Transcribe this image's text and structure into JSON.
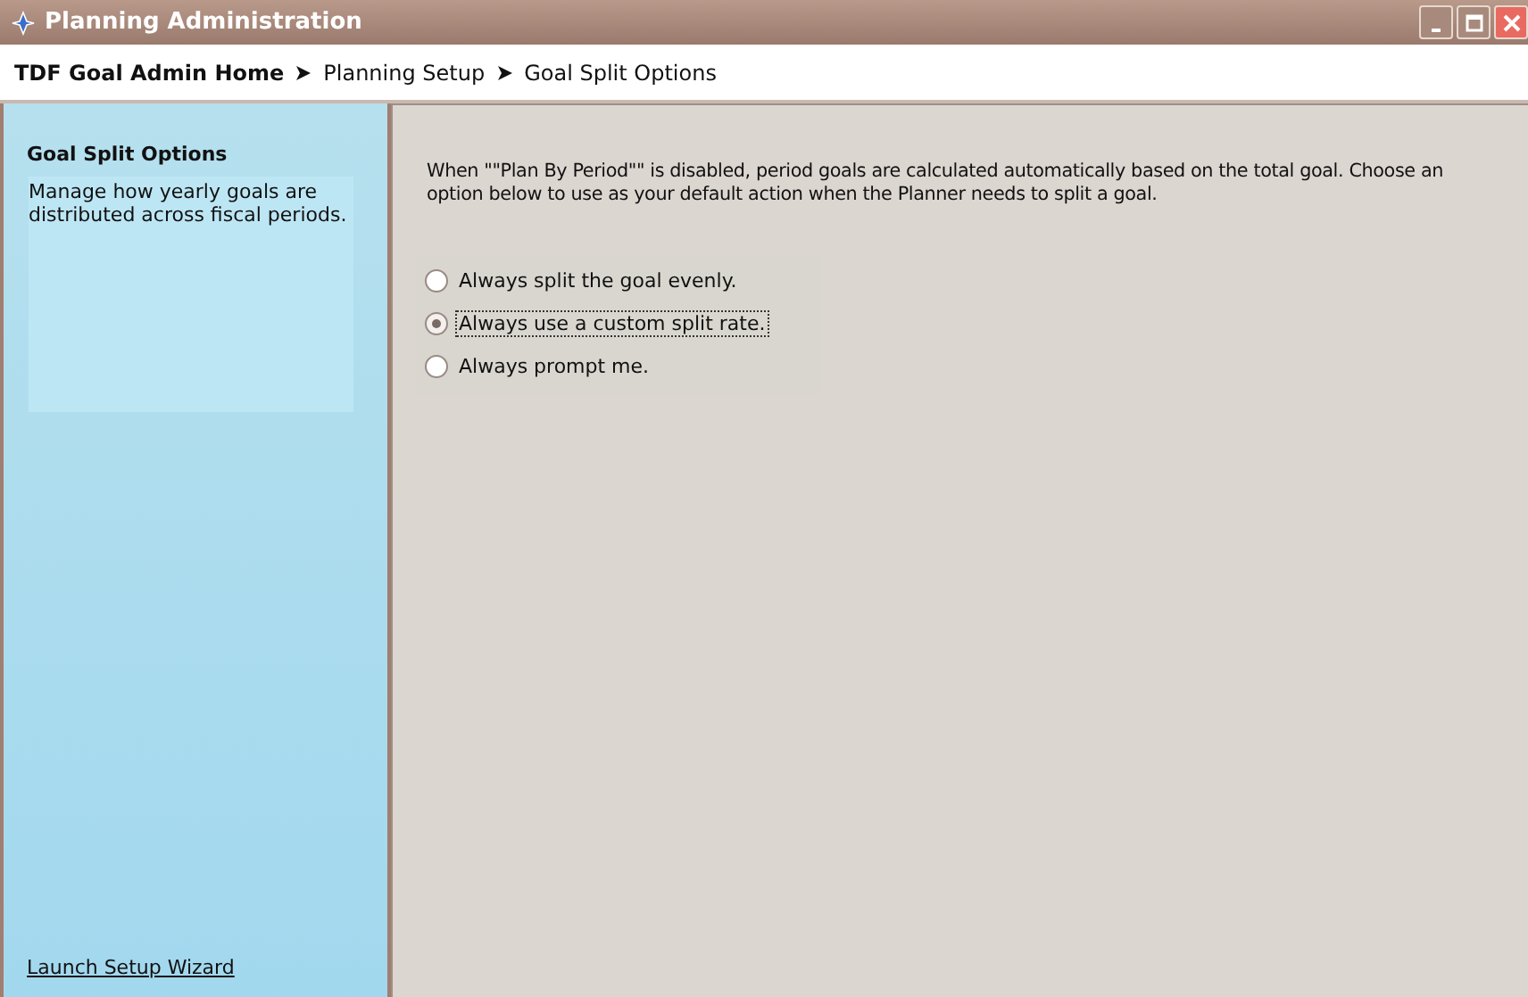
{
  "window": {
    "title": "Planning Administration"
  },
  "breadcrumb": [
    {
      "label": "TDF Goal Admin Home"
    },
    {
      "label": "Planning Setup"
    },
    {
      "label": "Goal Split Options"
    }
  ],
  "sidebar": {
    "heading": "Goal Split Options",
    "description": "Manage how yearly goals are distributed across fiscal periods.",
    "link": "Launch Setup Wizard"
  },
  "content": {
    "intro": "When \"\"Plan By Period\"\" is disabled, period goals are calculated automatically based on the total goal. Choose an option below to use as your default action when the Planner needs to split a goal.",
    "options": [
      {
        "label": "Always split the goal evenly.",
        "selected": false
      },
      {
        "label": "Always use a custom split rate.",
        "selected": true
      },
      {
        "label": "Always prompt me.",
        "selected": false
      }
    ]
  }
}
